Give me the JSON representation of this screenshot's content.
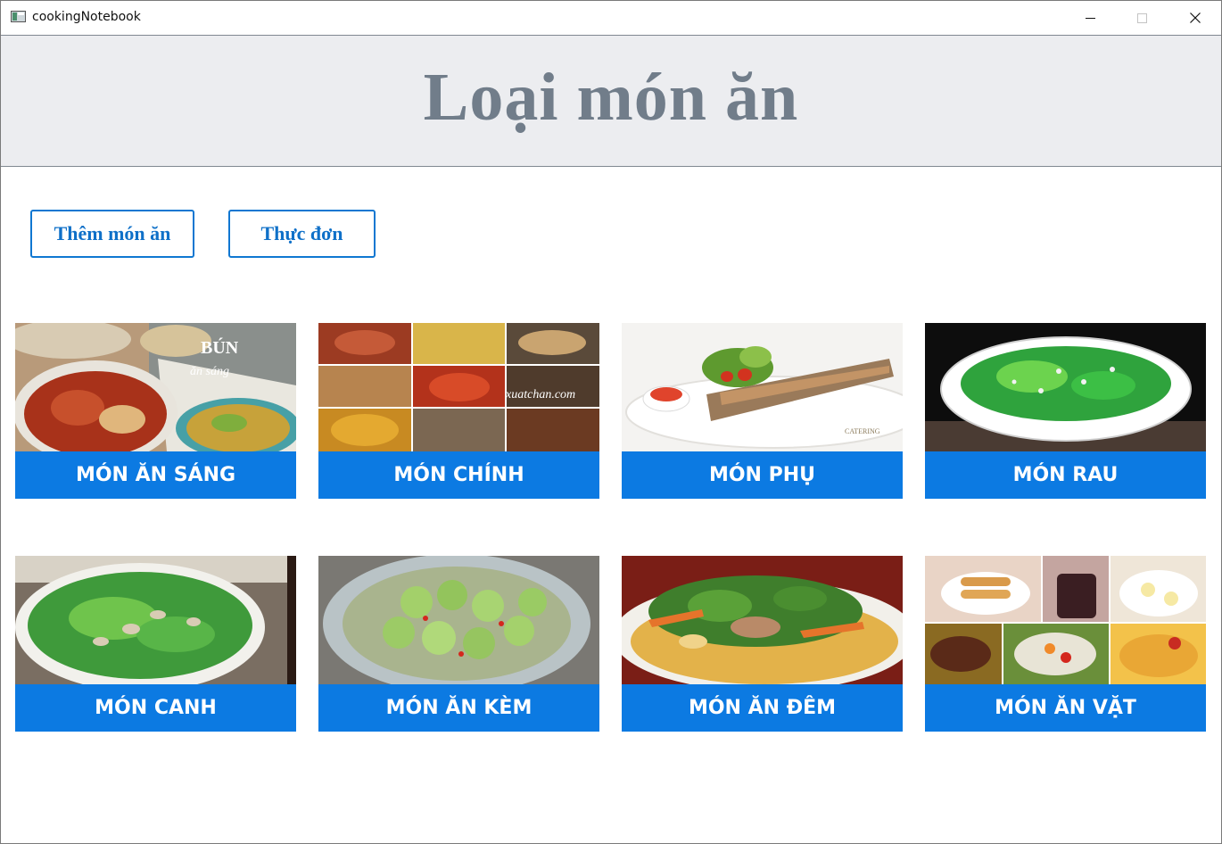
{
  "window": {
    "title": "cookingNotebook",
    "icon": "app-window-icon",
    "controls": [
      "minimize-icon",
      "maximize-icon",
      "close-icon"
    ]
  },
  "header": {
    "title": "Loại món ăn"
  },
  "actions": {
    "add_dish": "Thêm món ăn",
    "menu": "Thực đơn"
  },
  "categories": [
    {
      "label": "MÓN ĂN SÁNG",
      "photo_text": "BÚN",
      "photo_subtext": "ăn sáng"
    },
    {
      "label": "MÓN CHÍNH",
      "photo_text": "xuatchan.com"
    },
    {
      "label": "MÓN PHỤ",
      "photo_text": "CATERING"
    },
    {
      "label": "MÓN RAU"
    },
    {
      "label": "MÓN CANH"
    },
    {
      "label": "MÓN ĂN KÈM"
    },
    {
      "label": "MÓN ĂN ĐÊM"
    },
    {
      "label": "MÓN ĂN VẶT"
    }
  ],
  "colors": {
    "accent": "#0c7ae2",
    "button_border": "#0f77d1",
    "header_bg": "#ecedf0",
    "header_text": "#717d8a"
  }
}
